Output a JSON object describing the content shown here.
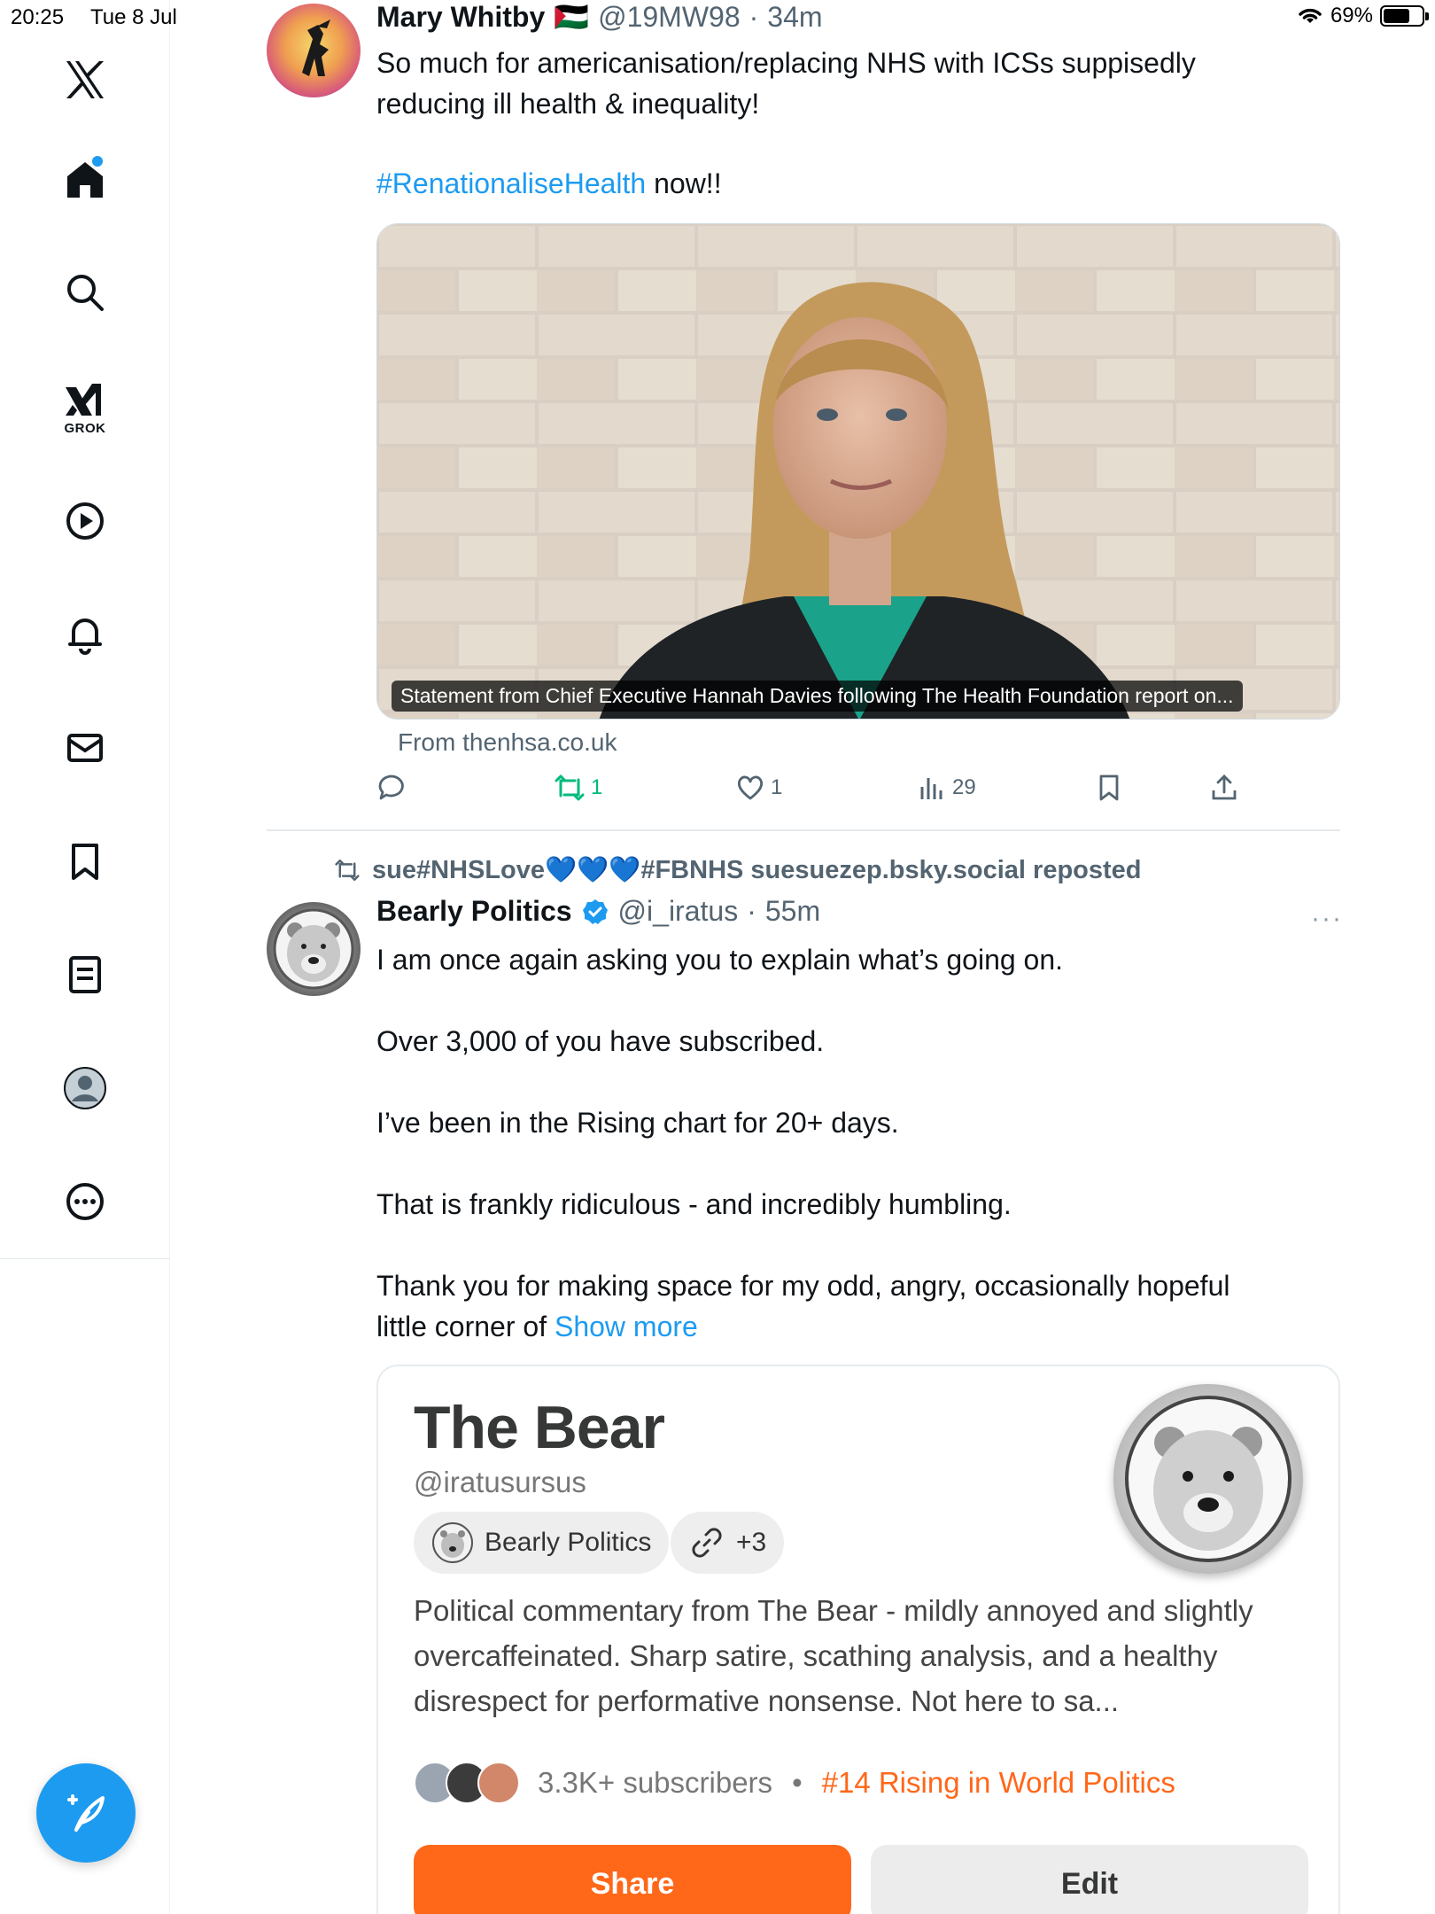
{
  "status_bar": {
    "time": "20:25",
    "date": "Tue 8 Jul",
    "battery": "69%"
  },
  "sidebar": {
    "items": [
      {
        "name": "x-logo-icon"
      },
      {
        "name": "home-icon"
      },
      {
        "name": "search-icon"
      },
      {
        "name": "grok-icon",
        "label": "GROK"
      },
      {
        "name": "video-icon"
      },
      {
        "name": "notifications-icon"
      },
      {
        "name": "messages-icon"
      },
      {
        "name": "bookmarks-icon"
      },
      {
        "name": "lists-icon"
      },
      {
        "name": "profile-icon"
      },
      {
        "name": "more-icon"
      }
    ],
    "compose_icon": "compose-feather-icon"
  },
  "tweet1": {
    "name": "Mary Whitby",
    "flag": "🇵🇸",
    "handle": "@19MW98",
    "time": "34m",
    "text_line1": "So much for americanisation/replacing NHS with ICSs suppisedly reducing ill health & inequality!",
    "hashtag": "#RenationaliseHealth",
    "text_after_hashtag": " now!!",
    "media_caption": "Statement from Chief Executive Hannah Davies following The Health Foundation report on...",
    "source": "From thenhsa.co.uk",
    "counts": {
      "reposts": "1",
      "likes": "1",
      "views": "29"
    }
  },
  "tweet2": {
    "repost_by": "sue#NHSLove💙💙💙#FBNHS suesuezep.bsky.social reposted",
    "name": "Bearly Politics",
    "handle": "@i_iratus",
    "time": "55m",
    "paragraphs": [
      "I am once again asking you to explain what’s going on.",
      "Over 3,000 of you have subscribed.",
      "I’ve been in the Rising chart for 20+ days.",
      "That is frankly ridiculous - and incredibly humbling."
    ],
    "last_paragraph": "Thank you for making space for my odd, angry, occasionally hopeful little corner of ",
    "show_more": "Show more",
    "more": "···"
  },
  "card": {
    "title": "The Bear",
    "handle": "@iratusursus",
    "chip_name": "Bearly Politics",
    "chip_extra": "+3",
    "description": "Political commentary from The Bear - mildly annoyed and slightly overcaffeinated. Sharp satire, scathing analysis, and a healthy disrespect for performative nonsense. Not here to sa...",
    "subscribers": "3.3K+ subscribers",
    "dot": "•",
    "rising": "#14 Rising in World Politics",
    "share": "Share",
    "edit": "Edit",
    "accent": "#ff6719"
  },
  "colors": {
    "link": "#1d9bf0",
    "repost_green": "#00ba7c",
    "muted": "#536471"
  }
}
